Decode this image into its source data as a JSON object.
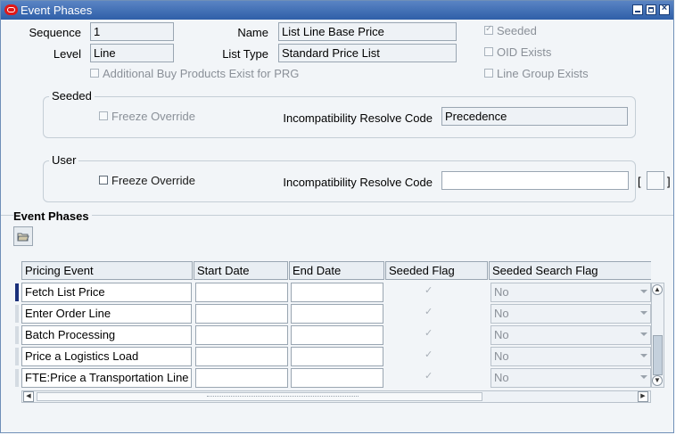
{
  "window": {
    "title": "Event Phases"
  },
  "header": {
    "sequence_label": "Sequence",
    "sequence_value": "1",
    "name_label": "Name",
    "name_value": "List Line Base Price",
    "level_label": "Level",
    "level_value": "Line",
    "list_type_label": "List Type",
    "list_type_value": "Standard Price List",
    "seeded_label": "Seeded",
    "oid_exists_label": "OID Exists",
    "line_group_label": "Line Group Exists",
    "additional_buy_label": "Additional Buy Products Exist for PRG"
  },
  "seeded_group": {
    "title": "Seeded",
    "freeze_override_label": "Freeze Override",
    "resolve_label": "Incompatibility Resolve Code",
    "resolve_value": "Precedence"
  },
  "user_group": {
    "title": "User",
    "freeze_override_label": "Freeze Override",
    "resolve_label": "Incompatibility Resolve Code",
    "resolve_value": "",
    "bracket_open": "[",
    "bracket_close": "]"
  },
  "phases": {
    "section_title": "Event Phases",
    "columns": [
      "Pricing Event",
      "Start Date",
      "End Date",
      "Seeded Flag",
      "Seeded Search Flag"
    ],
    "rows": [
      {
        "event": "Fetch List Price",
        "start": "",
        "end": "",
        "search": "No"
      },
      {
        "event": "Enter Order Line",
        "start": "",
        "end": "",
        "search": "No"
      },
      {
        "event": "Batch Processing",
        "start": "",
        "end": "",
        "search": "No"
      },
      {
        "event": "Price a Logistics Load",
        "start": "",
        "end": "",
        "search": "No"
      },
      {
        "event": "FTE:Price a Transportation  Line",
        "start": "",
        "end": "",
        "search": "No"
      }
    ]
  }
}
